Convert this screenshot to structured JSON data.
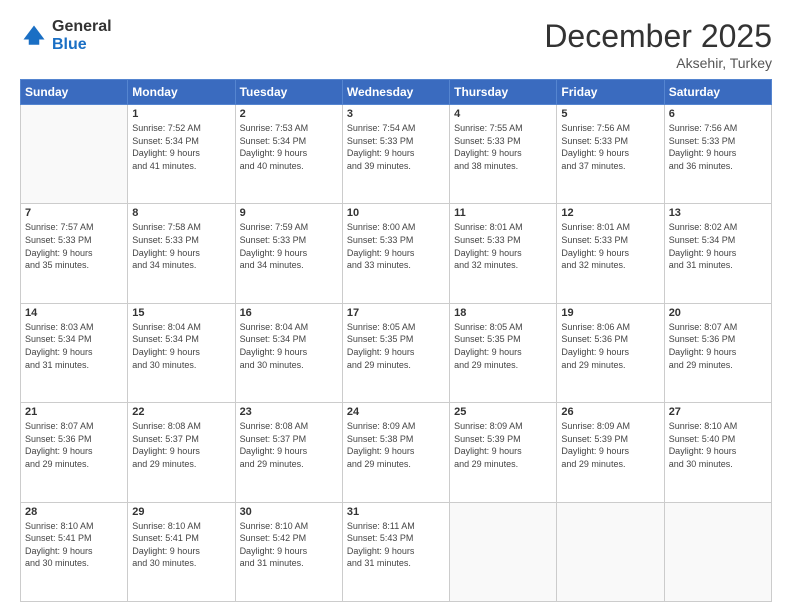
{
  "logo": {
    "general": "General",
    "blue": "Blue"
  },
  "header": {
    "title": "December 2025",
    "subtitle": "Aksehir, Turkey"
  },
  "weekdays": [
    "Sunday",
    "Monday",
    "Tuesday",
    "Wednesday",
    "Thursday",
    "Friday",
    "Saturday"
  ],
  "weeks": [
    [
      {
        "day": "",
        "info": ""
      },
      {
        "day": "1",
        "info": "Sunrise: 7:52 AM\nSunset: 5:34 PM\nDaylight: 9 hours\nand 41 minutes."
      },
      {
        "day": "2",
        "info": "Sunrise: 7:53 AM\nSunset: 5:34 PM\nDaylight: 9 hours\nand 40 minutes."
      },
      {
        "day": "3",
        "info": "Sunrise: 7:54 AM\nSunset: 5:33 PM\nDaylight: 9 hours\nand 39 minutes."
      },
      {
        "day": "4",
        "info": "Sunrise: 7:55 AM\nSunset: 5:33 PM\nDaylight: 9 hours\nand 38 minutes."
      },
      {
        "day": "5",
        "info": "Sunrise: 7:56 AM\nSunset: 5:33 PM\nDaylight: 9 hours\nand 37 minutes."
      },
      {
        "day": "6",
        "info": "Sunrise: 7:56 AM\nSunset: 5:33 PM\nDaylight: 9 hours\nand 36 minutes."
      }
    ],
    [
      {
        "day": "7",
        "info": "Sunrise: 7:57 AM\nSunset: 5:33 PM\nDaylight: 9 hours\nand 35 minutes."
      },
      {
        "day": "8",
        "info": "Sunrise: 7:58 AM\nSunset: 5:33 PM\nDaylight: 9 hours\nand 34 minutes."
      },
      {
        "day": "9",
        "info": "Sunrise: 7:59 AM\nSunset: 5:33 PM\nDaylight: 9 hours\nand 34 minutes."
      },
      {
        "day": "10",
        "info": "Sunrise: 8:00 AM\nSunset: 5:33 PM\nDaylight: 9 hours\nand 33 minutes."
      },
      {
        "day": "11",
        "info": "Sunrise: 8:01 AM\nSunset: 5:33 PM\nDaylight: 9 hours\nand 32 minutes."
      },
      {
        "day": "12",
        "info": "Sunrise: 8:01 AM\nSunset: 5:33 PM\nDaylight: 9 hours\nand 32 minutes."
      },
      {
        "day": "13",
        "info": "Sunrise: 8:02 AM\nSunset: 5:34 PM\nDaylight: 9 hours\nand 31 minutes."
      }
    ],
    [
      {
        "day": "14",
        "info": "Sunrise: 8:03 AM\nSunset: 5:34 PM\nDaylight: 9 hours\nand 31 minutes."
      },
      {
        "day": "15",
        "info": "Sunrise: 8:04 AM\nSunset: 5:34 PM\nDaylight: 9 hours\nand 30 minutes."
      },
      {
        "day": "16",
        "info": "Sunrise: 8:04 AM\nSunset: 5:34 PM\nDaylight: 9 hours\nand 30 minutes."
      },
      {
        "day": "17",
        "info": "Sunrise: 8:05 AM\nSunset: 5:35 PM\nDaylight: 9 hours\nand 29 minutes."
      },
      {
        "day": "18",
        "info": "Sunrise: 8:05 AM\nSunset: 5:35 PM\nDaylight: 9 hours\nand 29 minutes."
      },
      {
        "day": "19",
        "info": "Sunrise: 8:06 AM\nSunset: 5:36 PM\nDaylight: 9 hours\nand 29 minutes."
      },
      {
        "day": "20",
        "info": "Sunrise: 8:07 AM\nSunset: 5:36 PM\nDaylight: 9 hours\nand 29 minutes."
      }
    ],
    [
      {
        "day": "21",
        "info": "Sunrise: 8:07 AM\nSunset: 5:36 PM\nDaylight: 9 hours\nand 29 minutes."
      },
      {
        "day": "22",
        "info": "Sunrise: 8:08 AM\nSunset: 5:37 PM\nDaylight: 9 hours\nand 29 minutes."
      },
      {
        "day": "23",
        "info": "Sunrise: 8:08 AM\nSunset: 5:37 PM\nDaylight: 9 hours\nand 29 minutes."
      },
      {
        "day": "24",
        "info": "Sunrise: 8:09 AM\nSunset: 5:38 PM\nDaylight: 9 hours\nand 29 minutes."
      },
      {
        "day": "25",
        "info": "Sunrise: 8:09 AM\nSunset: 5:39 PM\nDaylight: 9 hours\nand 29 minutes."
      },
      {
        "day": "26",
        "info": "Sunrise: 8:09 AM\nSunset: 5:39 PM\nDaylight: 9 hours\nand 29 minutes."
      },
      {
        "day": "27",
        "info": "Sunrise: 8:10 AM\nSunset: 5:40 PM\nDaylight: 9 hours\nand 30 minutes."
      }
    ],
    [
      {
        "day": "28",
        "info": "Sunrise: 8:10 AM\nSunset: 5:41 PM\nDaylight: 9 hours\nand 30 minutes."
      },
      {
        "day": "29",
        "info": "Sunrise: 8:10 AM\nSunset: 5:41 PM\nDaylight: 9 hours\nand 30 minutes."
      },
      {
        "day": "30",
        "info": "Sunrise: 8:10 AM\nSunset: 5:42 PM\nDaylight: 9 hours\nand 31 minutes."
      },
      {
        "day": "31",
        "info": "Sunrise: 8:11 AM\nSunset: 5:43 PM\nDaylight: 9 hours\nand 31 minutes."
      },
      {
        "day": "",
        "info": ""
      },
      {
        "day": "",
        "info": ""
      },
      {
        "day": "",
        "info": ""
      }
    ]
  ]
}
